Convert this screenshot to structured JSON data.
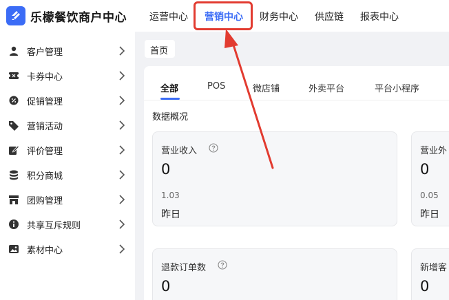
{
  "app": {
    "brand": "乐檬餐饮商户中心",
    "accent": "#3b6cf6",
    "highlight_color": "#e23b30"
  },
  "topnav": {
    "items": [
      {
        "label": "运营中心",
        "active": false
      },
      {
        "label": "营销中心",
        "active": true
      },
      {
        "label": "财务中心",
        "active": false
      },
      {
        "label": "供应链",
        "active": false
      },
      {
        "label": "报表中心",
        "active": false
      }
    ]
  },
  "sidebar": {
    "items": [
      {
        "label": "客户管理",
        "icon": "user-icon"
      },
      {
        "label": "卡券中心",
        "icon": "coupon-icon"
      },
      {
        "label": "促销管理",
        "icon": "promo-gear-icon"
      },
      {
        "label": "营销活动",
        "icon": "tag-icon"
      },
      {
        "label": "评价管理",
        "icon": "review-edit-icon"
      },
      {
        "label": "积分商城",
        "icon": "coins-stack-icon"
      },
      {
        "label": "团购管理",
        "icon": "storefront-icon"
      },
      {
        "label": "共享互斥规则",
        "icon": "info-icon"
      },
      {
        "label": "素材中心",
        "icon": "image-icon"
      }
    ]
  },
  "breadcrumb": {
    "home": "首页"
  },
  "tabs": [
    {
      "label": "全部",
      "active": true
    },
    {
      "label": "POS",
      "active": false
    },
    {
      "label": "微店铺",
      "active": false
    },
    {
      "label": "外卖平台",
      "active": false
    },
    {
      "label": "平台小程序",
      "active": false
    }
  ],
  "overview": {
    "title": "数据概况",
    "cards": [
      {
        "title": "营业收入",
        "value": "0",
        "sub": "1.03",
        "label": "昨日"
      },
      {
        "title": "营业外",
        "value": "0",
        "sub": "0.05",
        "label": "昨日"
      },
      {
        "title": "退款订单数",
        "value": "0"
      },
      {
        "title": "新增客",
        "value": "0"
      }
    ]
  }
}
